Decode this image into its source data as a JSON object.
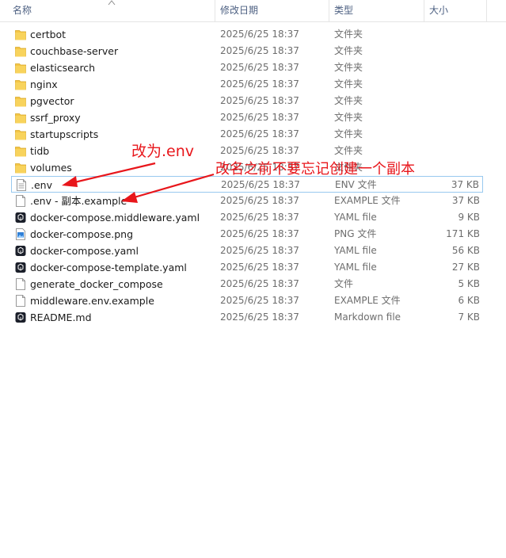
{
  "header": {
    "name": "名称",
    "date": "修改日期",
    "type": "类型",
    "size": "大小"
  },
  "files": [
    {
      "icon": "folder-icon",
      "name": "certbot",
      "date": "2025/6/25 18:37",
      "type": "文件夹",
      "size": ""
    },
    {
      "icon": "folder-icon",
      "name": "couchbase-server",
      "date": "2025/6/25 18:37",
      "type": "文件夹",
      "size": ""
    },
    {
      "icon": "folder-icon",
      "name": "elasticsearch",
      "date": "2025/6/25 18:37",
      "type": "文件夹",
      "size": ""
    },
    {
      "icon": "folder-icon",
      "name": "nginx",
      "date": "2025/6/25 18:37",
      "type": "文件夹",
      "size": ""
    },
    {
      "icon": "folder-icon",
      "name": "pgvector",
      "date": "2025/6/25 18:37",
      "type": "文件夹",
      "size": ""
    },
    {
      "icon": "folder-icon",
      "name": "ssrf_proxy",
      "date": "2025/6/25 18:37",
      "type": "文件夹",
      "size": ""
    },
    {
      "icon": "folder-icon",
      "name": "startupscripts",
      "date": "2025/6/25 18:37",
      "type": "文件夹",
      "size": ""
    },
    {
      "icon": "folder-icon",
      "name": "tidb",
      "date": "2025/6/25 18:37",
      "type": "文件夹",
      "size": ""
    },
    {
      "icon": "folder-icon",
      "name": "volumes",
      "date": "2025/6/25 18:37",
      "type": "文件夹",
      "size": ""
    },
    {
      "icon": "text-file-icon",
      "name": ".env",
      "date": "2025/6/25 18:37",
      "type": "ENV 文件",
      "size": "37 KB"
    },
    {
      "icon": "blank-file-icon",
      "name": ".env - 副本.example",
      "date": "2025/6/25 18:37",
      "type": "EXAMPLE 文件",
      "size": "37 KB"
    },
    {
      "icon": "app-file-icon",
      "name": "docker-compose.middleware.yaml",
      "date": "2025/6/25 18:37",
      "type": "YAML file",
      "size": "9 KB"
    },
    {
      "icon": "image-file-icon",
      "name": "docker-compose.png",
      "date": "2025/6/25 18:37",
      "type": "PNG 文件",
      "size": "171 KB"
    },
    {
      "icon": "app-file-icon",
      "name": "docker-compose.yaml",
      "date": "2025/6/25 18:37",
      "type": "YAML file",
      "size": "56 KB"
    },
    {
      "icon": "app-file-icon",
      "name": "docker-compose-template.yaml",
      "date": "2025/6/25 18:37",
      "type": "YAML file",
      "size": "27 KB"
    },
    {
      "icon": "blank-file-icon",
      "name": "generate_docker_compose",
      "date": "2025/6/25 18:37",
      "type": "文件",
      "size": "5 KB"
    },
    {
      "icon": "blank-file-icon",
      "name": "middleware.env.example",
      "date": "2025/6/25 18:37",
      "type": "EXAMPLE 文件",
      "size": "6 KB"
    },
    {
      "icon": "app-file-icon",
      "name": "README.md",
      "date": "2025/6/25 18:37",
      "type": "Markdown file",
      "size": "7 KB"
    }
  ],
  "annotations": {
    "rename_note": "改为.env",
    "copy_note": "改名之前不要忘记创建一个副本",
    "color": "#e8161b"
  },
  "colors": {
    "header_text": "#4d6082",
    "folder": "#f4c545",
    "selection_border": "#99c9ef"
  }
}
